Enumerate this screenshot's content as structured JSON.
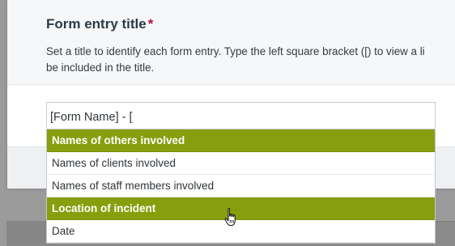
{
  "modal": {
    "title": "Form entry title",
    "required_mark": "*",
    "description_line1": "Set a title to identify each form entry. Type the left square bracket ([) to view a li",
    "description_line2": "be included in the title."
  },
  "entry_title_field": {
    "value": "[Form Name] - ["
  },
  "dropdown": {
    "items": [
      {
        "label": "Names of others involved",
        "type": "group"
      },
      {
        "label": "Names of clients involved",
        "type": "option"
      },
      {
        "label": "Names of staff members involved",
        "type": "option"
      },
      {
        "label": "Location of incident",
        "type": "group"
      },
      {
        "label": "Date",
        "type": "option"
      }
    ]
  },
  "colors": {
    "group_header": "#879f0d",
    "required_mark": "#b4113b"
  },
  "icons": {
    "pointer": "hand-pointer-icon"
  }
}
